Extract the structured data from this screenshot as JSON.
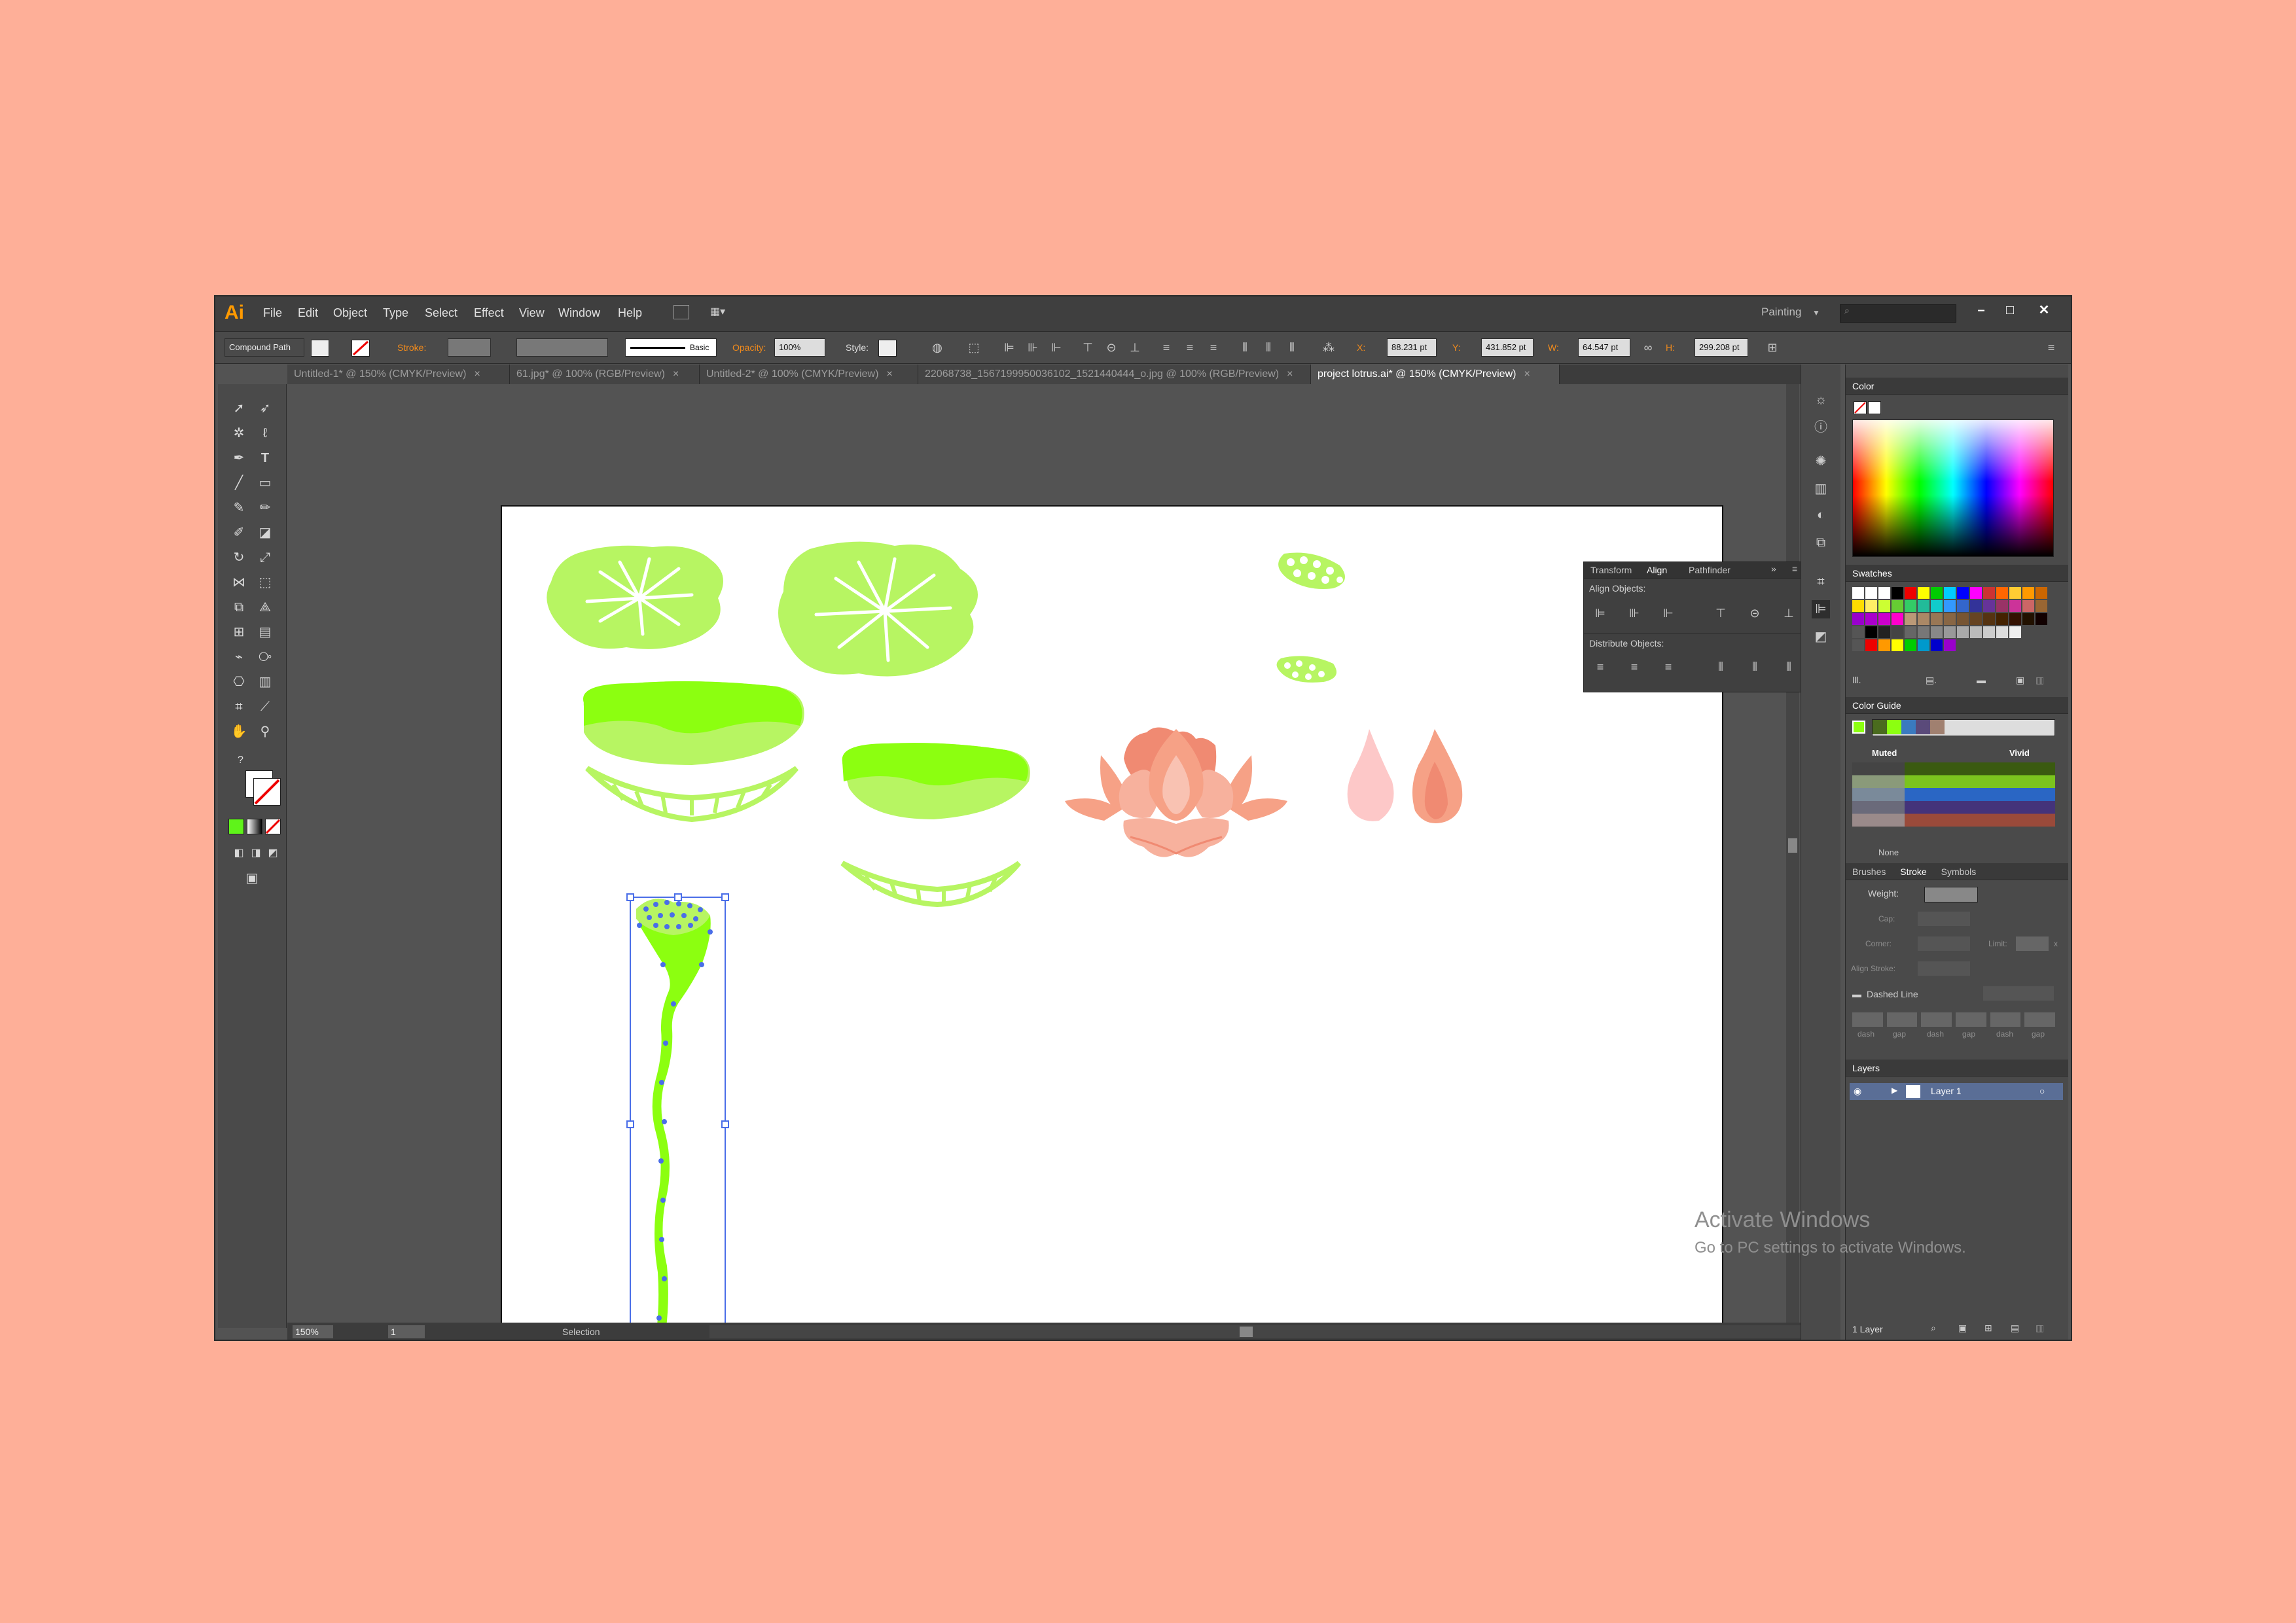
{
  "app": {
    "logo": "Ai"
  },
  "menu": [
    "File",
    "Edit",
    "Object",
    "Type",
    "Select",
    "Effect",
    "View",
    "Window",
    "Help"
  ],
  "workspace": {
    "name": "Painting"
  },
  "control": {
    "selection_type": "Compound Path",
    "stroke_label": "Stroke:",
    "brush": "Basic",
    "opacity_label": "Opacity:",
    "opacity_value": "100%",
    "style_label": "Style:",
    "x_label": "X:",
    "x_value": "88.231 pt",
    "y_label": "Y:",
    "y_value": "431.852 pt",
    "w_label": "W:",
    "w_value": "64.547 pt",
    "h_label": "H:",
    "h_value": "299.208 pt"
  },
  "tabs": [
    {
      "label": "Untitled-1* @ 150% (CMYK/Preview)",
      "active": false
    },
    {
      "label": "61.jpg* @ 100% (RGB/Preview)",
      "active": false
    },
    {
      "label": "Untitled-2* @ 100% (CMYK/Preview)",
      "active": false
    },
    {
      "label": "22068738_1567199950036102_1521440444_o.jpg @ 100% (RGB/Preview)",
      "active": false
    },
    {
      "label": "project lotrus.ai* @ 150% (CMYK/Preview)",
      "active": true
    }
  ],
  "tab_close": "×",
  "status": {
    "zoom": "150%",
    "page": "1",
    "mode": "Selection"
  },
  "align_panel": {
    "tabs": [
      "Transform",
      "Align",
      "Pathfinder"
    ],
    "active_tab": "Align",
    "align_objects": "Align Objects:",
    "distribute_objects": "Distribute Objects:"
  },
  "panels": {
    "color": {
      "title": "Color"
    },
    "swatches": {
      "title": "Swatches"
    },
    "color_guide": {
      "title": "Color Guide",
      "muted": "Muted",
      "vivid": "Vivid",
      "none": "None"
    },
    "stroke": {
      "tabs": [
        "Brushes",
        "Stroke",
        "Symbols"
      ],
      "weight": "Weight:",
      "cap": "Cap:",
      "corner": "Corner:",
      "limit": "Limit:",
      "limit_unit": "x",
      "align_stroke": "Align Stroke:",
      "dashed_line": "Dashed Line",
      "dash_labels": [
        "dash",
        "gap",
        "dash",
        "gap",
        "dash",
        "gap"
      ]
    },
    "layers": {
      "title": "Layers",
      "layer_name": "Layer 1",
      "footer": "1 Layer"
    }
  },
  "watermark": {
    "line1": "Activate Windows",
    "line2": "Go to PC settings to activate Windows."
  },
  "colors": {
    "accent_orange": "#ff9a00",
    "artwork_green": "#8cff10",
    "artwork_light_green": "#b7f562",
    "lotus_pink": "#f6a186",
    "selection_blue": "#4a6ee8"
  }
}
